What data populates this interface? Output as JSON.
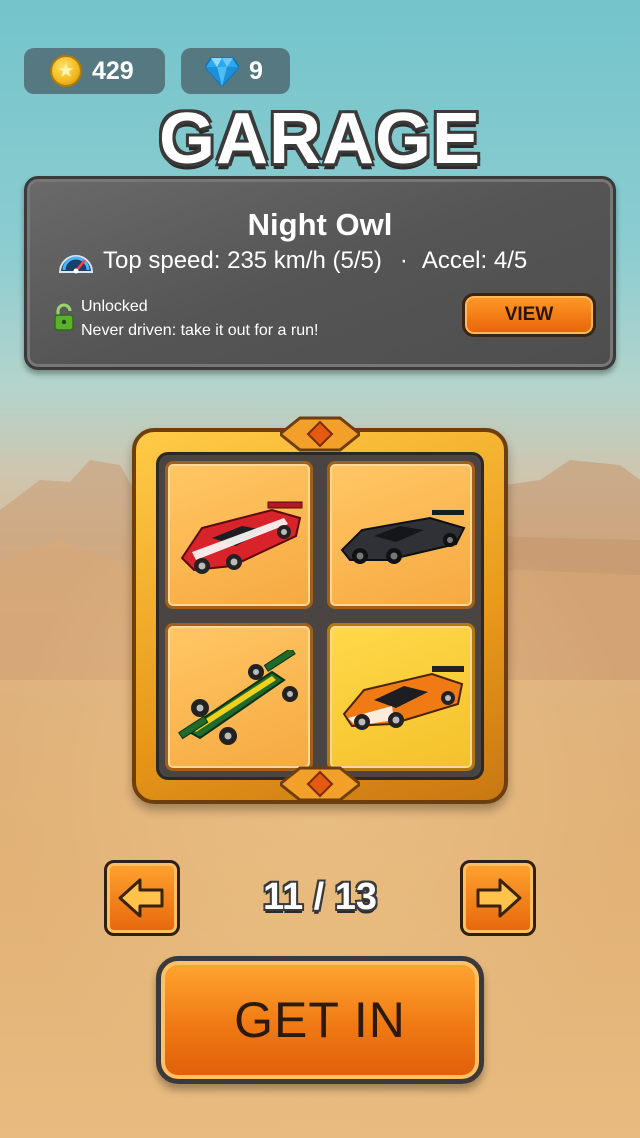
{
  "currency": {
    "coins": "429",
    "gems": "9"
  },
  "title": "GARAGE",
  "selected_car": {
    "name": "Night Owl",
    "top_speed_label": "Top speed: 235 km/h (5/5)",
    "separator": "·",
    "accel_label": "Accel: 4/5",
    "status": "Unlocked",
    "note": "Never driven: take it out for a run!",
    "view_label": "VIEW"
  },
  "grid": {
    "cars": [
      {
        "icon": "red-race-car-icon",
        "color": "#d8232a",
        "selected": false
      },
      {
        "icon": "black-hypercar-icon",
        "color": "#2f3136",
        "selected": false
      },
      {
        "icon": "green-formula-car-icon",
        "color": "#1e6b2c",
        "selected": false
      },
      {
        "icon": "orange-prototype-car-icon",
        "color": "#f07a14",
        "selected": true
      }
    ]
  },
  "pager": {
    "label": "11 / 13"
  },
  "cta": {
    "label": "GET IN"
  }
}
